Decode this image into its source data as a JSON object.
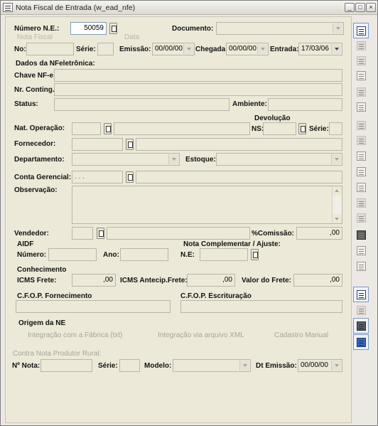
{
  "window": {
    "title": "Nota Fiscal de Entrada (w_ead_nfe)",
    "min": "_",
    "max": "□",
    "close": "×"
  },
  "header": {
    "numero_label": "Número N.E.:",
    "numero_value": "50059",
    "documento_label": "Documento:",
    "nota_fiscal_group": "Nota Fiscal",
    "data_group": "Data",
    "no_label": "No:",
    "serie_label": "Série:",
    "emissao_label": "Emissão:",
    "emissao_value": "00/00/00",
    "chegada_label": "Chegada:",
    "chegada_value": "00/00/00",
    "entrada_label": "Entrada:",
    "entrada_value": "17/03/06"
  },
  "nfe": {
    "section": "Dados da NFeletrônica:",
    "chave_label": "Chave NF-e:",
    "contig_label": "Nr. Conting.:",
    "status_label": "Status:",
    "ambiente_label": "Ambiente:"
  },
  "operacao": {
    "devolucao_label": "Devolução",
    "nat_label": "Nat. Operação:",
    "ns_label": "NS:",
    "serie_label": "Série:",
    "fornecedor_label": "Fornecedor:",
    "departamento_label": "Departamento:",
    "estoque_label": "Estoque:",
    "conta_label": "Conta Gerencial:",
    "conta_value": ". . .",
    "obs_label": "Observação:",
    "vendedor_label": "Vendedor:",
    "comissao_label": "%Comissão:",
    "comissao_value": ",00"
  },
  "aidf": {
    "section": "AIDF",
    "numero_label": "Número:",
    "ano_label": "Ano:",
    "complementar_label": "Nota Complementar / Ajuste:",
    "ne_label": "N.E:"
  },
  "conhecimento": {
    "section": "Conhecimento",
    "icms_label": "ICMS Frete:",
    "icms_value": ",00",
    "antecip_label": "ICMS Antecip.Frete:",
    "antecip_value": ",00",
    "valor_label": "Valor do Frete:",
    "valor_value": ",00"
  },
  "cfop": {
    "fornecimento_label": "C.F.O.P. Fornecimento",
    "escrituracao_label": "C.F.O.P. Escrituração"
  },
  "origem": {
    "section": "Origem da NE",
    "opt1": "Integração com a Fábrica (txt)",
    "opt2": "Integração via arquivo XML",
    "opt3": "Cadastro Manual"
  },
  "produtor": {
    "section": "Contra Nota Produtor Rural:",
    "nota_label": "Nº Nota:",
    "serie_label": "Série:",
    "modelo_label": "Modelo:",
    "dt_label": "Dt Emissão:",
    "dt_value": "00/00/00"
  },
  "toolbar_icons": [
    "insert-row-icon",
    "grid-icon",
    "search-icon",
    "folder-tools-icon",
    "list-icon",
    "lightning-icon",
    "blank-icon",
    "trash-icon",
    "archive-icon",
    "edit-sheet-icon",
    "split-sheet-icon",
    "sheet-gear-icon",
    "sheet-lines-icon",
    "print-tools-icon",
    "stamp-icon",
    "document-icon",
    "new-grid-icon",
    "open-folder-icon",
    "calculator-icon",
    "exit-door-icon"
  ]
}
